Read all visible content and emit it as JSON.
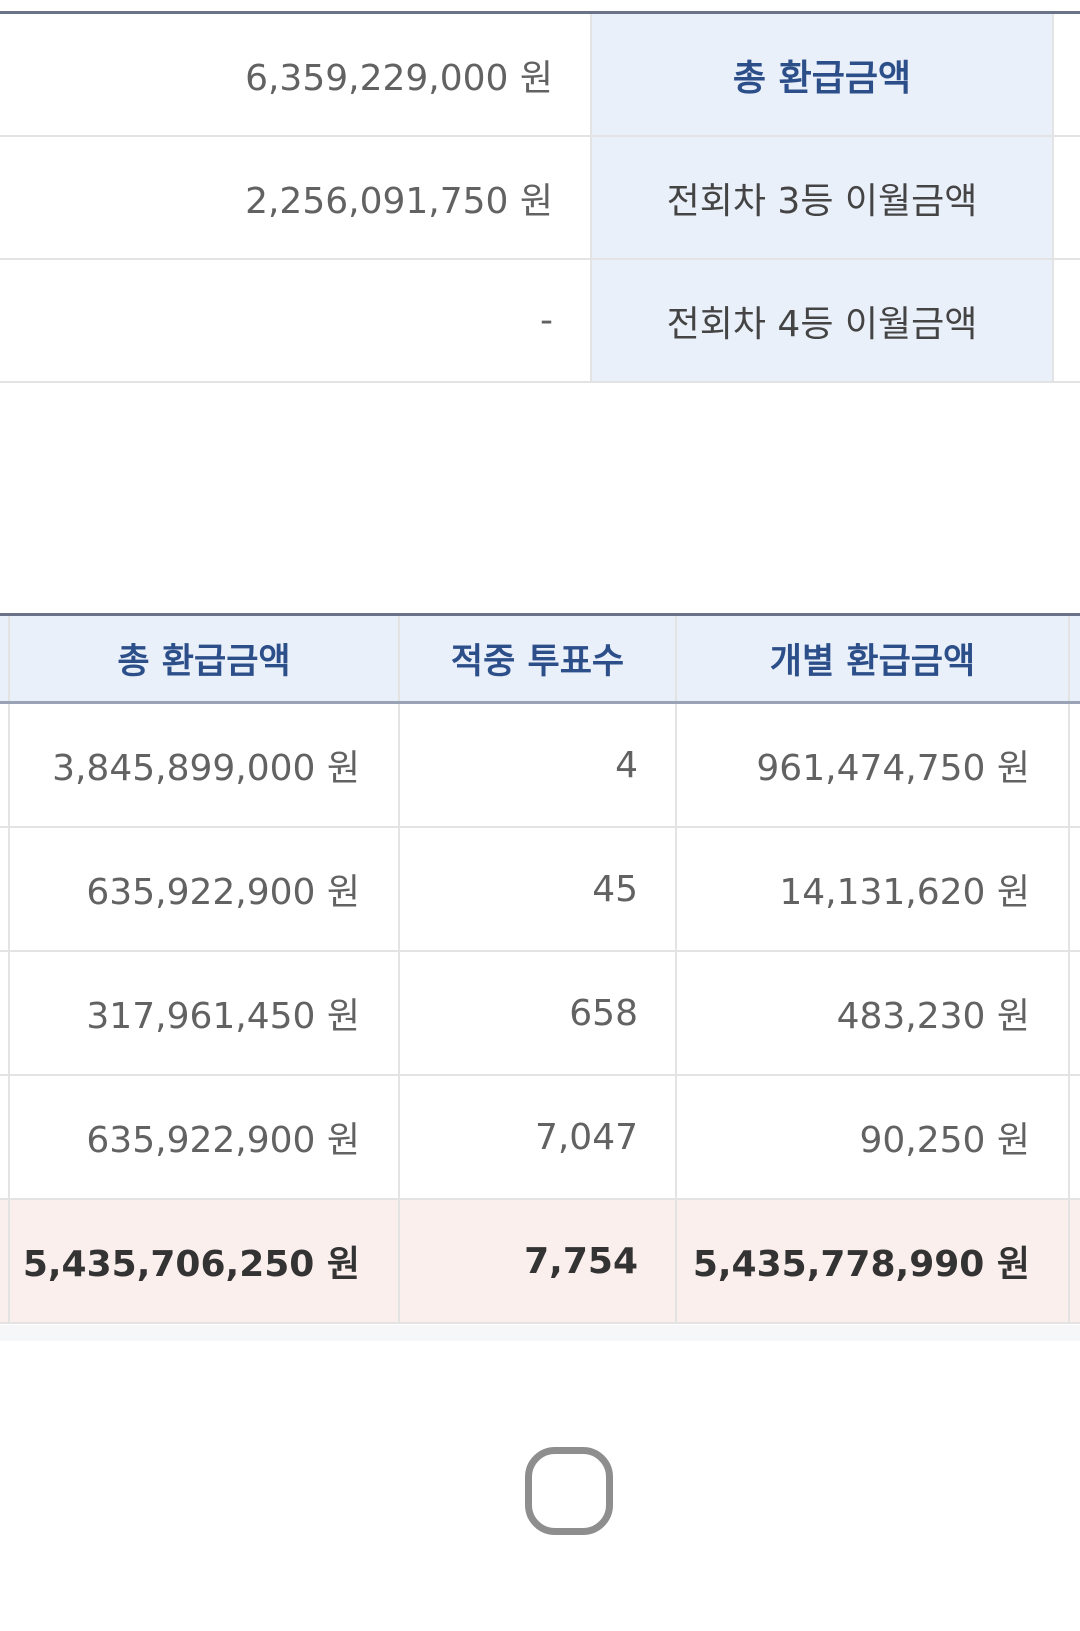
{
  "summary": {
    "rows": [
      {
        "value": "6,359,229,000 원",
        "label": "총 환급금액"
      },
      {
        "value": "2,256,091,750 원",
        "label": "전회차 3등 이월금액"
      },
      {
        "value": "-",
        "label": "전회차 4등 이월금액"
      }
    ]
  },
  "prize_table": {
    "headers": [
      "총 환급금액",
      "적중 투표수",
      "개별 환급금액"
    ],
    "rows": [
      {
        "total": "3,845,899,000 원",
        "votes": "4",
        "individual": "961,474,750 원"
      },
      {
        "total": "635,922,900 원",
        "votes": "45",
        "individual": "14,131,620 원"
      },
      {
        "total": "317,961,450 원",
        "votes": "658",
        "individual": "483,230 원"
      },
      {
        "total": "635,922,900 원",
        "votes": "7,047",
        "individual": "90,250 원"
      }
    ],
    "sum": {
      "total": "5,435,706,250 원",
      "votes": "7,754",
      "individual": "5,435,778,990 원"
    }
  },
  "nav": {
    "home_icon": "home-button-icon"
  },
  "colors": {
    "header_bg": "#eaf0fa",
    "header_text": "#2c4f8a",
    "total_row_bg": "#fbefed",
    "border": "#e3e3e3",
    "top_rule": "#6b7388"
  }
}
